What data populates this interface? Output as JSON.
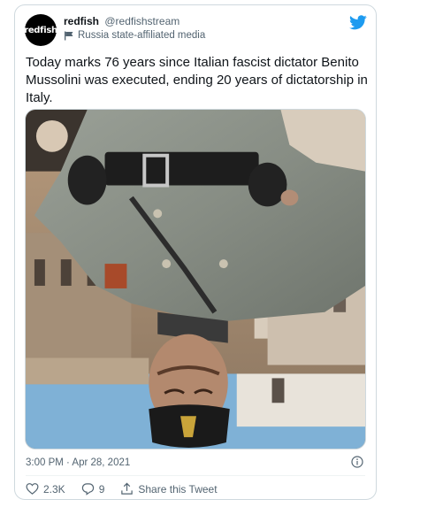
{
  "account": {
    "avatar_text": "redfish",
    "display_name": "redfish",
    "handle": "@redfishstream",
    "state_label": "Russia state-affiliated media"
  },
  "tweet": {
    "text": "Today marks 76 years since Italian fascist dictator Benito Mussolini was executed, ending 20 years of dictatorship in Italy.",
    "timestamp": "3:00 PM · Apr 28, 2021"
  },
  "actions": {
    "likes": "2.3K",
    "replies": "9",
    "share_label": "Share this Tweet"
  },
  "colors": {
    "twitter_blue": "#1d9bf0",
    "secondary_text": "#536471",
    "border": "#cfd9de"
  },
  "icons": [
    "flag-icon",
    "twitter-bird-icon",
    "info-icon",
    "heart-icon",
    "reply-icon",
    "share-icon"
  ]
}
